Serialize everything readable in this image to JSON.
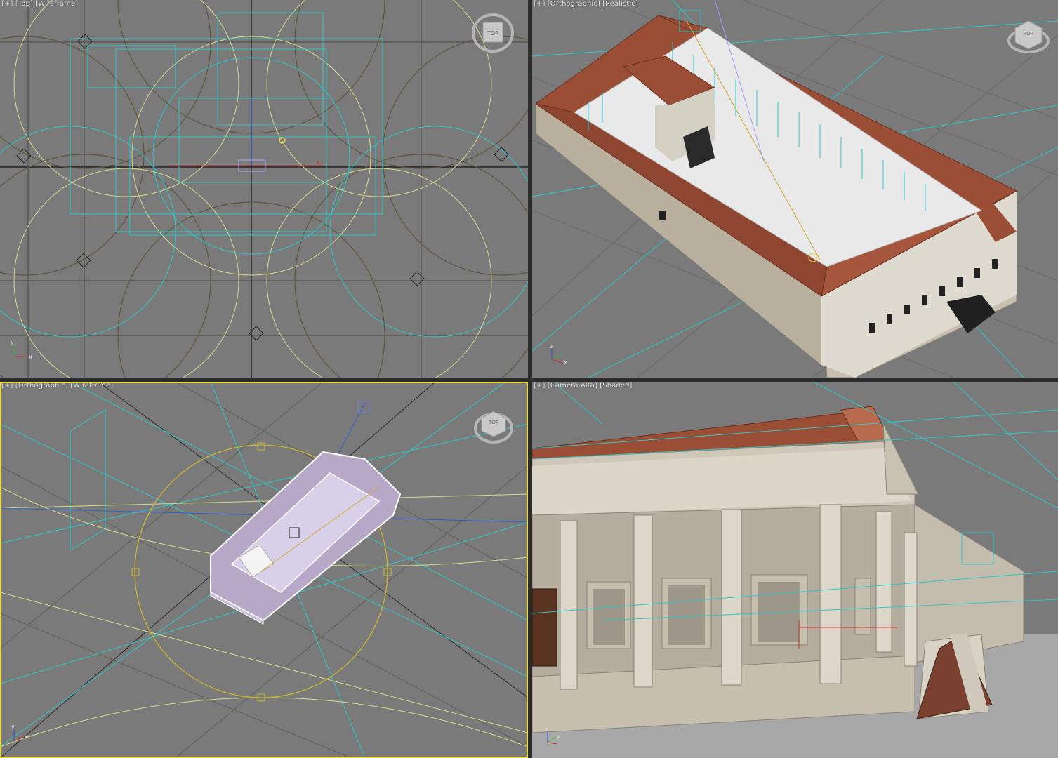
{
  "viewports": [
    {
      "id": "top",
      "label_plus": "[+]",
      "label_view": "[Top]",
      "label_mode": "[Wireframe]",
      "viewcube_face": "TOP",
      "active": false
    },
    {
      "id": "ortho-realistic",
      "label_plus": "[+]",
      "label_view": "[Orthographic]",
      "label_mode": "[Realistic]",
      "viewcube_face": "TOP",
      "active": false
    },
    {
      "id": "ortho-wireframe",
      "label_plus": "[+]",
      "label_view": "[Orthographic]",
      "label_mode": "[Wireframe]",
      "viewcube_face": "TOP",
      "active": true
    },
    {
      "id": "camera",
      "label_plus": "[+]",
      "label_view": "[Camera Alta]",
      "label_mode": "[Shaded]",
      "viewcube_face": "",
      "active": false
    }
  ],
  "axes": {
    "x": "x",
    "y": "y",
    "z": "z"
  },
  "colors": {
    "viewport_bg": "#7a7a7a",
    "active_border": "#e6d84a",
    "grid_dark": "#4a4a42",
    "wire_cyan": "#2fc7c7",
    "wire_yellow": "#d8d890",
    "roof": "#9a4e36",
    "wall": "#cfc8b8"
  },
  "icons": [
    "viewcube-icon",
    "axis-tripod-icon"
  ]
}
